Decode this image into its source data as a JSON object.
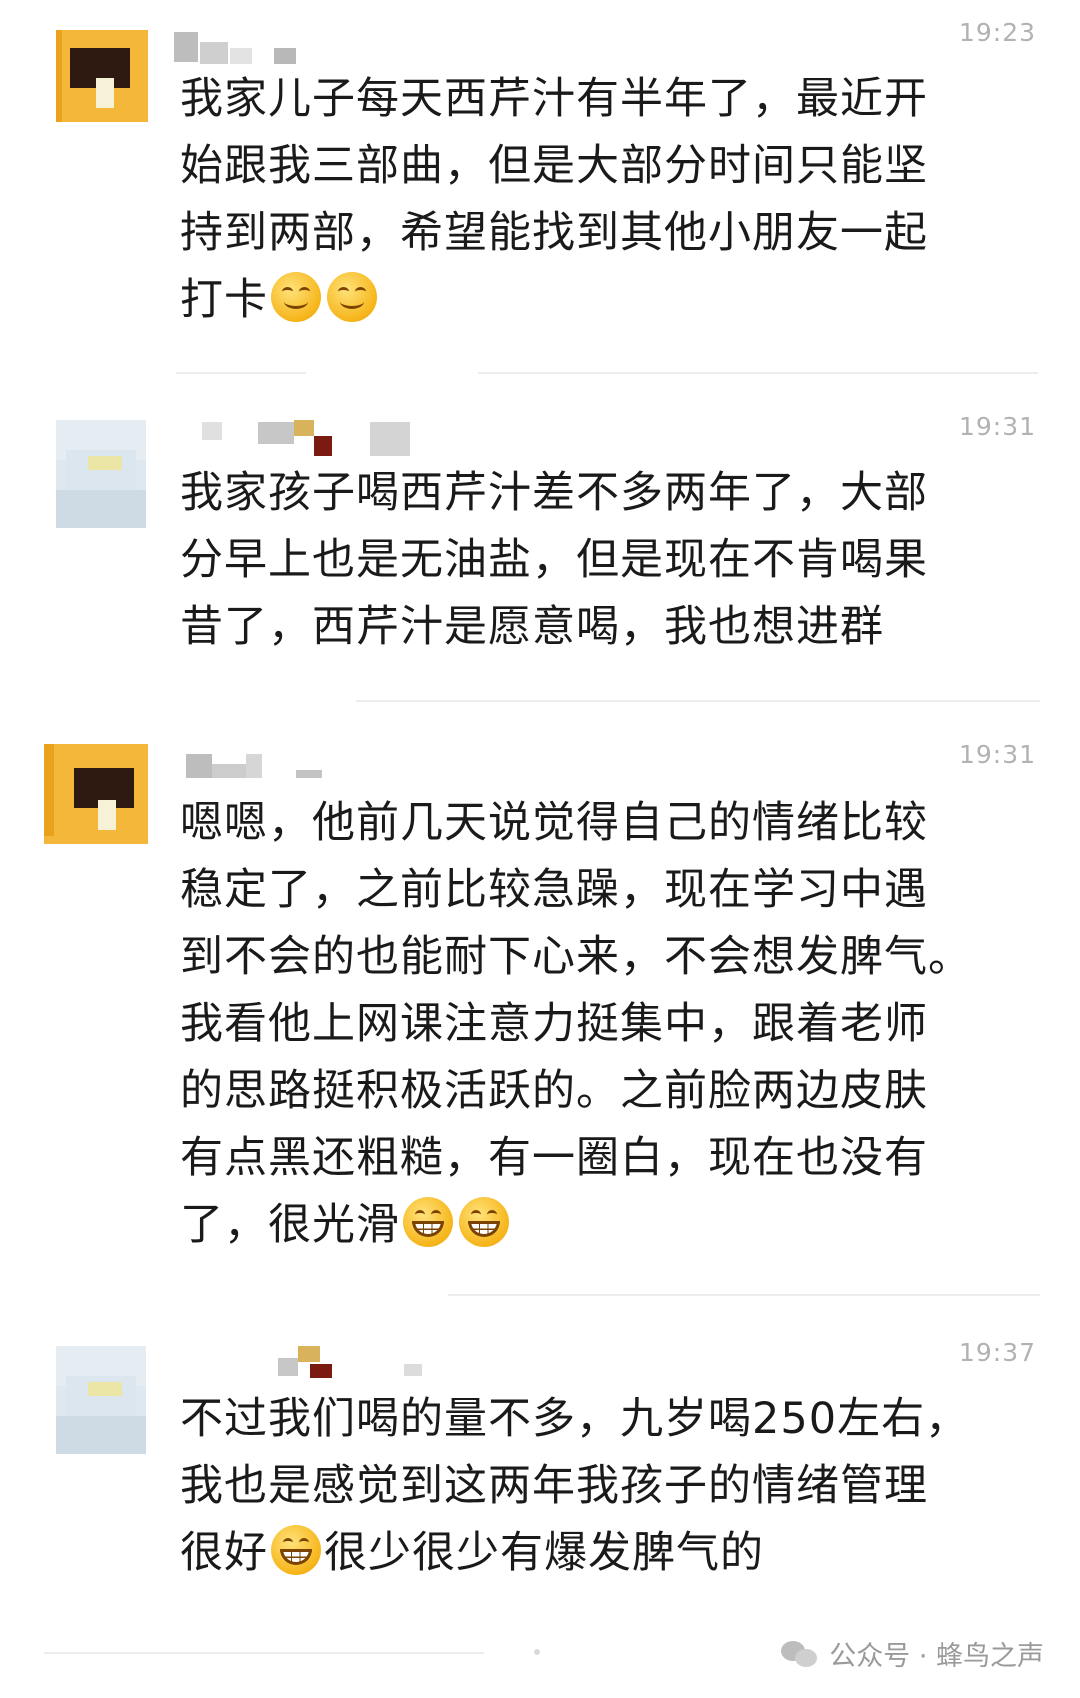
{
  "messages": [
    {
      "time": "19:23",
      "lines": [
        "我家儿子每天西芹汁有半年了，最近开",
        "始跟我三部曲，但是大部分时间只能坚",
        "持到两部，希望能找到其他小朋友一起",
        "打卡"
      ],
      "emoji_after": "smile, smile"
    },
    {
      "time": "19:31",
      "lines": [
        "我家孩子喝西芹汁差不多两年了，大部",
        "分早上也是无油盐，但是现在不肯喝果",
        "昔了，西芹汁是愿意喝，我也想进群"
      ]
    },
    {
      "time": "19:31",
      "lines": [
        "嗯嗯，他前几天说觉得自己的情绪比较",
        "稳定了，之前比较急躁，现在学习中遇",
        "到不会的也能耐下心来，不会想发脾气。",
        "我看他上网课注意力挺集中，跟着老师",
        "的思路挺积极活跃的。之前脸两边皮肤",
        "有点黑还粗糙，有一圈白，现在也没有",
        "了，很光滑"
      ],
      "emoji_after": "grin, grin"
    },
    {
      "time": "19:37",
      "lines": [
        "不过我们喝的量不多，九岁喝250左右，",
        "我也是感觉到这两年我孩子的情绪管理"
      ],
      "last_line_before": "很好",
      "last_line_after": "很少很少有爆发脾气的"
    }
  ],
  "footer": {
    "text": "公众号 · 蜂鸟之声",
    "icon": "wechat-icon"
  }
}
